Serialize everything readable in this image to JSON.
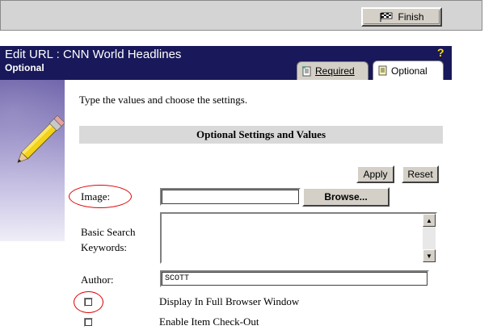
{
  "toolbar": {
    "finish_label": "Finish"
  },
  "header": {
    "title": "Edit URL : CNN World Headlines",
    "subtitle": "Optional",
    "help_symbol": "?"
  },
  "tabs": [
    {
      "label": "Required",
      "active": false
    },
    {
      "label": "Optional",
      "active": true
    }
  ],
  "main": {
    "intro_text": "Type the values and choose the settings.",
    "section_title": "Optional Settings and Values",
    "apply_label": "Apply",
    "reset_label": "Reset",
    "browse_label": "Browse..."
  },
  "fields": {
    "image_label": "Image:",
    "image_value": "",
    "keywords_label_line1": "Basic Search",
    "keywords_label_line2": "Keywords:",
    "keywords_value": "",
    "author_label": "Author:",
    "author_value": "SCOTT"
  },
  "checkboxes": [
    {
      "label": "Display In Full Browser Window",
      "checked": false
    },
    {
      "label": "Enable Item Check-Out",
      "checked": false
    }
  ],
  "colors": {
    "header_bg": "#18185a",
    "help_color": "#ffe000",
    "annotation_red": "#e00000",
    "section_bg": "#d9d9d9"
  },
  "icons": {
    "finish": "checkered-flag-icon",
    "tab": "document-icon",
    "banner": "pencil-icon"
  }
}
